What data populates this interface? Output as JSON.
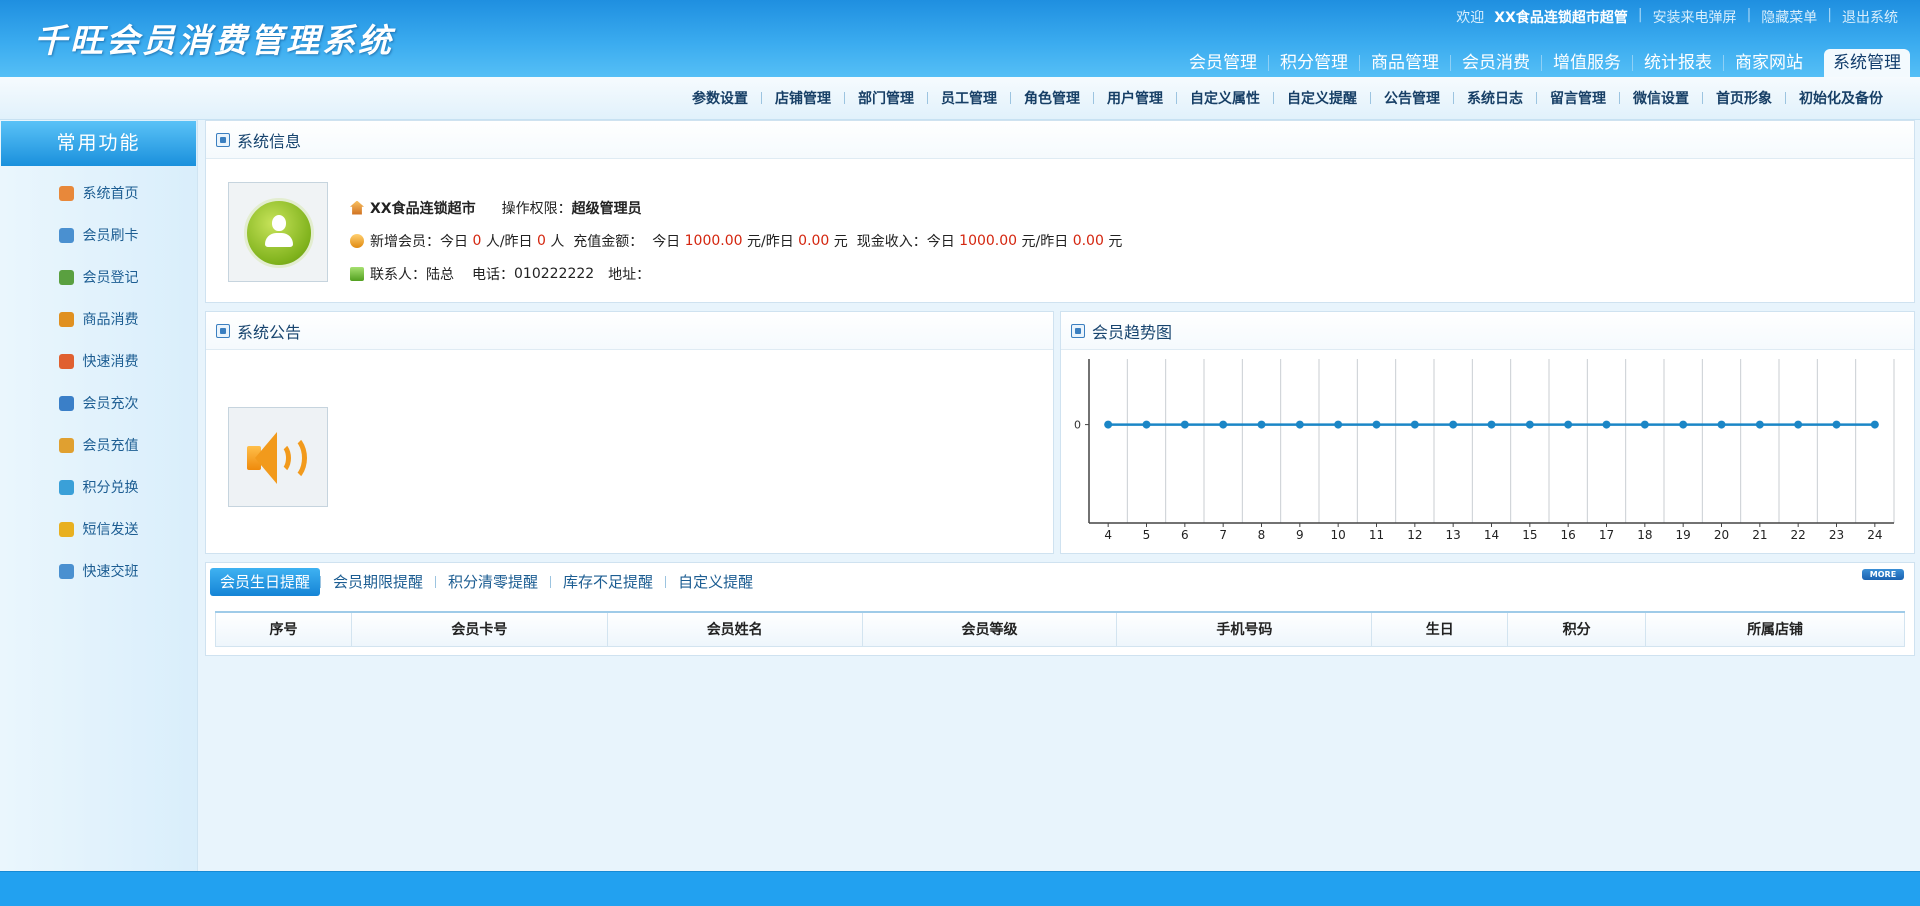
{
  "app_title": "千旺会员消费管理系统",
  "toplinks": {
    "welcome": "欢迎",
    "user": "XX食品连锁超市超管",
    "install_popup": "安装来电弹屏",
    "hide_menu": "隐藏菜单",
    "logout": "退出系统"
  },
  "main_nav": [
    "会员管理",
    "积分管理",
    "商品管理",
    "会员消费",
    "增值服务",
    "统计报表",
    "商家网站"
  ],
  "main_nav_active": "系统管理",
  "sub_nav": [
    "参数设置",
    "店铺管理",
    "部门管理",
    "员工管理",
    "角色管理",
    "用户管理",
    "自定义属性",
    "自定义提醒",
    "公告管理",
    "系统日志",
    "留言管理",
    "微信设置",
    "首页形象",
    "初始化及备份"
  ],
  "sidebar": {
    "title": "常用功能",
    "items": [
      {
        "label": "系统首页",
        "icon": "home-icon",
        "color": "#e8883a"
      },
      {
        "label": "会员刷卡",
        "icon": "member-card-icon",
        "color": "#4a90d0"
      },
      {
        "label": "会员登记",
        "icon": "member-register-icon",
        "color": "#5aa040"
      },
      {
        "label": "商品消费",
        "icon": "cart-icon",
        "color": "#e09020"
      },
      {
        "label": "快速消费",
        "icon": "quick-consume-icon",
        "color": "#e06030"
      },
      {
        "label": "会员充次",
        "icon": "recharge-times-icon",
        "color": "#3a7fc8"
      },
      {
        "label": "会员充值",
        "icon": "recharge-icon",
        "color": "#e0a030"
      },
      {
        "label": "积分兑换",
        "icon": "gift-icon",
        "color": "#3aa0d8"
      },
      {
        "label": "短信发送",
        "icon": "mail-icon",
        "color": "#e8b020"
      },
      {
        "label": "快速交班",
        "icon": "shift-icon",
        "color": "#4a90d0"
      }
    ]
  },
  "system_info": {
    "title": "系统信息",
    "store_name": "XX食品连锁超市",
    "perm_label": "操作权限：",
    "perm_value": "超级管理员",
    "new_member_label": "新增会员：今日",
    "new_today": "0",
    "unit_person_yesterday": "人/昨日",
    "new_yesterday": "0",
    "unit_person": "人",
    "recharge_label": "充值金额：",
    "today_label": "今日",
    "recharge_today": "1000.00",
    "unit_yuan_yesterday": "元/昨日",
    "recharge_yesterday": "0.00",
    "unit_yuan": "元",
    "cash_label": "现金收入：今日",
    "cash_today": "1000.00",
    "cash_unit_yesterday": "元/昨日",
    "cash_yesterday": "0.00",
    "cash_unit": "元",
    "contact_label": "联系人：",
    "contact": "陆总",
    "phone_label": "电话：",
    "phone": "010222222",
    "address_label": "地址："
  },
  "notice": {
    "title": "系统公告"
  },
  "trend": {
    "title": "会员趋势图"
  },
  "chart_data": {
    "type": "line",
    "x": [
      4,
      5,
      6,
      7,
      8,
      9,
      10,
      11,
      12,
      13,
      14,
      15,
      16,
      17,
      18,
      19,
      20,
      21,
      22,
      23,
      24
    ],
    "series": [
      {
        "values": [
          0,
          0,
          0,
          0,
          0,
          0,
          0,
          0,
          0,
          0,
          0,
          0,
          0,
          0,
          0,
          0,
          0,
          0,
          0,
          0,
          0
        ],
        "color": "#1b86c6"
      }
    ],
    "y_ticks": [
      0
    ],
    "grid": true
  },
  "reminder_tabs": [
    "会员生日提醒",
    "会员期限提醒",
    "积分清零提醒",
    "库存不足提醒",
    "自定义提醒"
  ],
  "more_label": "MORE",
  "reminder_columns": [
    "序号",
    "会员卡号",
    "会员姓名",
    "会员等级",
    "手机号码",
    "生日",
    "积分",
    "所属店铺"
  ]
}
